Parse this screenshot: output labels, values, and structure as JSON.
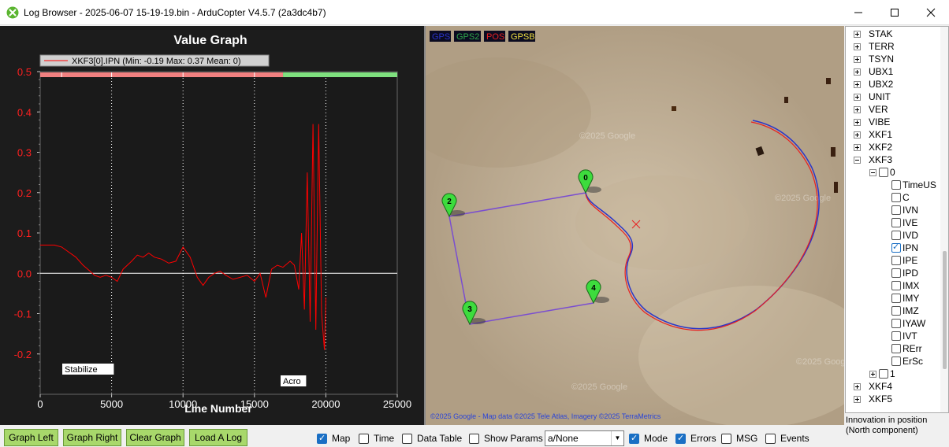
{
  "window": {
    "title": "Log Browser - 2025-06-07 15-19-19.bin - ArduCopter V4.5.7 (2a3dc4b7)",
    "minimize_icon": "minimize-icon",
    "maximize_icon": "maximize-icon",
    "close_icon": "close-icon"
  },
  "graph": {
    "title": "Value Graph",
    "legend": "XKF3[0].IPN  (Min: -0.19 Max: 0.37 Mean: 0)",
    "x_label": "Line Number",
    "mode_labels": [
      "Stabilize",
      "Acro"
    ],
    "colors": {
      "background": "#1c1c1c",
      "series": "#ff0000",
      "axis_text": "#ff2020",
      "mode_bar_a": "#f08080",
      "mode_bar_b": "#7fe07f"
    }
  },
  "chart_data": {
    "type": "line",
    "title": "Value Graph",
    "xlabel": "Line Number",
    "ylabel": "",
    "xlim": [
      0,
      25000
    ],
    "ylim": [
      -0.3,
      0.5
    ],
    "x_ticks": [
      "0",
      "5000",
      "10000",
      "15000",
      "20000",
      "25000"
    ],
    "y_ticks": [
      "0.5",
      "0.4",
      "0.3",
      "0.2",
      "0.1",
      "0.0",
      "-0.1",
      "-0.2"
    ],
    "series": [
      {
        "name": "XKF3[0].IPN",
        "x": [
          0,
          1000,
          1500,
          2500,
          3000,
          3500,
          3800,
          4200,
          4600,
          5000,
          5400,
          5800,
          6400,
          6800,
          7200,
          7600,
          8000,
          8500,
          9000,
          9500,
          10000,
          10500,
          11000,
          11400,
          11800,
          12200,
          12600,
          13000,
          13500,
          14000,
          14500,
          15000,
          15400,
          15800,
          16200,
          16600,
          17000,
          17500,
          17800,
          18100,
          18300,
          18500,
          18700,
          18900,
          19100,
          19300,
          19500,
          19700,
          19900,
          20000
        ],
        "y": [
          0.07,
          0.07,
          0.065,
          0.04,
          0.02,
          0.005,
          -0.005,
          -0.01,
          -0.005,
          -0.01,
          -0.02,
          0.01,
          0.03,
          0.045,
          0.04,
          0.05,
          0.04,
          0.035,
          0.025,
          0.03,
          0.065,
          0.04,
          -0.01,
          -0.03,
          -0.01,
          0.0,
          0.005,
          -0.005,
          -0.015,
          -0.01,
          -0.005,
          -0.02,
          0.0,
          -0.06,
          0.01,
          0.02,
          0.015,
          0.03,
          0.02,
          -0.04,
          0.1,
          -0.09,
          0.25,
          -0.12,
          0.37,
          -0.14,
          0.37,
          -0.1,
          -0.19,
          -0.06
        ]
      }
    ],
    "mode_changes": [
      {
        "label": "Stabilize",
        "from": 0,
        "to": 17000
      },
      {
        "label": "Acro",
        "from": 17000,
        "to": 25000
      }
    ]
  },
  "map": {
    "legend": [
      {
        "label": "GPS",
        "color": "#2a34c8"
      },
      {
        "label": "GPS2",
        "color": "#2fa84a"
      },
      {
        "label": "POS",
        "color": "#e82020"
      },
      {
        "label": "GPSB",
        "color": "#f0e040"
      }
    ],
    "watermarks": [
      "©2025 Google",
      "©2025 Google",
      "©2025 Google",
      "©2025 Google"
    ],
    "attribution": "©2025 Google - Map data ©2025 Tele Atlas, Imagery ©2025 TerraMetrics",
    "waypoints": [
      "0",
      "2",
      "3",
      "4"
    ]
  },
  "tree": {
    "items": [
      {
        "label": "STAK",
        "level": 0,
        "kind": "plus"
      },
      {
        "label": "TERR",
        "level": 0,
        "kind": "plus"
      },
      {
        "label": "TSYN",
        "level": 0,
        "kind": "plus"
      },
      {
        "label": "UBX1",
        "level": 0,
        "kind": "plus"
      },
      {
        "label": "UBX2",
        "level": 0,
        "kind": "plus"
      },
      {
        "label": "UNIT",
        "level": 0,
        "kind": "plus"
      },
      {
        "label": "VER",
        "level": 0,
        "kind": "plus"
      },
      {
        "label": "VIBE",
        "level": 0,
        "kind": "plus"
      },
      {
        "label": "XKF1",
        "level": 0,
        "kind": "plus"
      },
      {
        "label": "XKF2",
        "level": 0,
        "kind": "plus"
      },
      {
        "label": "XKF3",
        "level": 0,
        "kind": "minus"
      },
      {
        "label": "0",
        "level": 1,
        "kind": "minus-check"
      },
      {
        "label": "TimeUS",
        "level": 2,
        "kind": "check"
      },
      {
        "label": "C",
        "level": 2,
        "kind": "check"
      },
      {
        "label": "IVN",
        "level": 2,
        "kind": "check"
      },
      {
        "label": "IVE",
        "level": 2,
        "kind": "check"
      },
      {
        "label": "IVD",
        "level": 2,
        "kind": "check"
      },
      {
        "label": "IPN",
        "level": 2,
        "kind": "checked"
      },
      {
        "label": "IPE",
        "level": 2,
        "kind": "check"
      },
      {
        "label": "IPD",
        "level": 2,
        "kind": "check"
      },
      {
        "label": "IMX",
        "level": 2,
        "kind": "check"
      },
      {
        "label": "IMY",
        "level": 2,
        "kind": "check"
      },
      {
        "label": "IMZ",
        "level": 2,
        "kind": "check"
      },
      {
        "label": "IYAW",
        "level": 2,
        "kind": "check"
      },
      {
        "label": "IVT",
        "level": 2,
        "kind": "check"
      },
      {
        "label": "RErr",
        "level": 2,
        "kind": "check"
      },
      {
        "label": "ErSc",
        "level": 2,
        "kind": "check"
      },
      {
        "label": "1",
        "level": 1,
        "kind": "plus-check"
      },
      {
        "label": "XKF4",
        "level": 0,
        "kind": "plus"
      },
      {
        "label": "XKF5",
        "level": 0,
        "kind": "plus"
      }
    ]
  },
  "status": {
    "description": "Innovation in position (North component)"
  },
  "buttons": {
    "graph_left": "Graph Left",
    "graph_right": "Graph Right",
    "clear_graph": "Clear Graph",
    "load_log": "Load A Log"
  },
  "checkboxes": {
    "map": {
      "label": "Map",
      "checked": true
    },
    "time": {
      "label": "Time",
      "checked": false
    },
    "data_table": {
      "label": "Data Table",
      "checked": false
    },
    "show_params": {
      "label": "Show Params",
      "checked": false
    },
    "mode": {
      "label": "Mode",
      "checked": true
    },
    "errors": {
      "label": "Errors",
      "checked": true
    },
    "msg": {
      "label": "MSG",
      "checked": false
    },
    "events": {
      "label": "Events",
      "checked": false
    }
  },
  "select": {
    "value": "a/None"
  }
}
